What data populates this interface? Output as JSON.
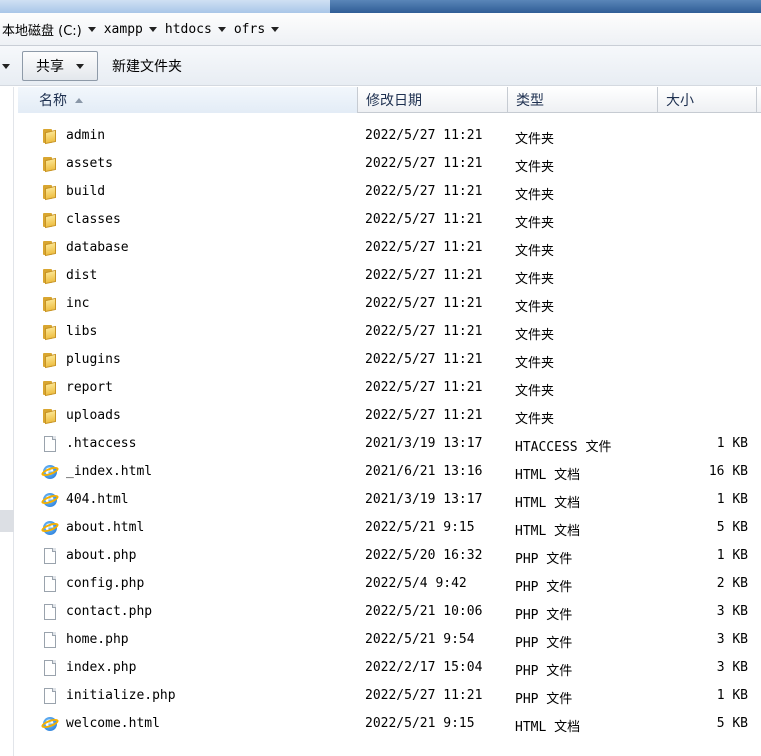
{
  "breadcrumb": [
    {
      "label": "本地磁盘 (C:)",
      "cjk": true
    },
    {
      "label": "xampp",
      "cjk": false
    },
    {
      "label": "htdocs",
      "cjk": false
    },
    {
      "label": "ofrs",
      "cjk": false
    }
  ],
  "toolbar": {
    "share_label": "共享",
    "new_folder_label": "新建文件夹"
  },
  "columns": {
    "name": "名称",
    "date": "修改日期",
    "type": "类型",
    "size": "大小"
  },
  "files": [
    {
      "name": "admin",
      "date": "2022/5/27 11:21",
      "type": "文件夹",
      "size": "",
      "icon": "folder-icon"
    },
    {
      "name": "assets",
      "date": "2022/5/27 11:21",
      "type": "文件夹",
      "size": "",
      "icon": "folder-icon"
    },
    {
      "name": "build",
      "date": "2022/5/27 11:21",
      "type": "文件夹",
      "size": "",
      "icon": "folder-icon"
    },
    {
      "name": "classes",
      "date": "2022/5/27 11:21",
      "type": "文件夹",
      "size": "",
      "icon": "folder-icon"
    },
    {
      "name": "database",
      "date": "2022/5/27 11:21",
      "type": "文件夹",
      "size": "",
      "icon": "folder-icon"
    },
    {
      "name": "dist",
      "date": "2022/5/27 11:21",
      "type": "文件夹",
      "size": "",
      "icon": "folder-icon"
    },
    {
      "name": "inc",
      "date": "2022/5/27 11:21",
      "type": "文件夹",
      "size": "",
      "icon": "folder-icon"
    },
    {
      "name": "libs",
      "date": "2022/5/27 11:21",
      "type": "文件夹",
      "size": "",
      "icon": "folder-icon"
    },
    {
      "name": "plugins",
      "date": "2022/5/27 11:21",
      "type": "文件夹",
      "size": "",
      "icon": "folder-icon"
    },
    {
      "name": "report",
      "date": "2022/5/27 11:21",
      "type": "文件夹",
      "size": "",
      "icon": "folder-icon"
    },
    {
      "name": "uploads",
      "date": "2022/5/27 11:21",
      "type": "文件夹",
      "size": "",
      "icon": "folder-icon"
    },
    {
      "name": ".htaccess",
      "date": "2021/3/19 13:17",
      "type": "HTACCESS 文件",
      "size": "1 KB",
      "icon": "file-icon"
    },
    {
      "name": "_index.html",
      "date": "2021/6/21 13:16",
      "type": "HTML 文档",
      "size": "16 KB",
      "icon": "ie-icon"
    },
    {
      "name": "404.html",
      "date": "2021/3/19 13:17",
      "type": "HTML 文档",
      "size": "1 KB",
      "icon": "ie-icon"
    },
    {
      "name": "about.html",
      "date": "2022/5/21 9:15",
      "type": "HTML 文档",
      "size": "5 KB",
      "icon": "ie-icon"
    },
    {
      "name": "about.php",
      "date": "2022/5/20 16:32",
      "type": "PHP 文件",
      "size": "1 KB",
      "icon": "file-icon"
    },
    {
      "name": "config.php",
      "date": "2022/5/4 9:42",
      "type": "PHP 文件",
      "size": "2 KB",
      "icon": "file-icon"
    },
    {
      "name": "contact.php",
      "date": "2022/5/21 10:06",
      "type": "PHP 文件",
      "size": "3 KB",
      "icon": "file-icon"
    },
    {
      "name": "home.php",
      "date": "2022/5/21 9:54",
      "type": "PHP 文件",
      "size": "3 KB",
      "icon": "file-icon"
    },
    {
      "name": "index.php",
      "date": "2022/2/17 15:04",
      "type": "PHP 文件",
      "size": "3 KB",
      "icon": "file-icon"
    },
    {
      "name": "initialize.php",
      "date": "2022/5/27 11:21",
      "type": "PHP 文件",
      "size": "1 KB",
      "icon": "file-icon"
    },
    {
      "name": "welcome.html",
      "date": "2022/5/21 9:15",
      "type": "HTML 文档",
      "size": "5 KB",
      "icon": "ie-icon"
    }
  ]
}
